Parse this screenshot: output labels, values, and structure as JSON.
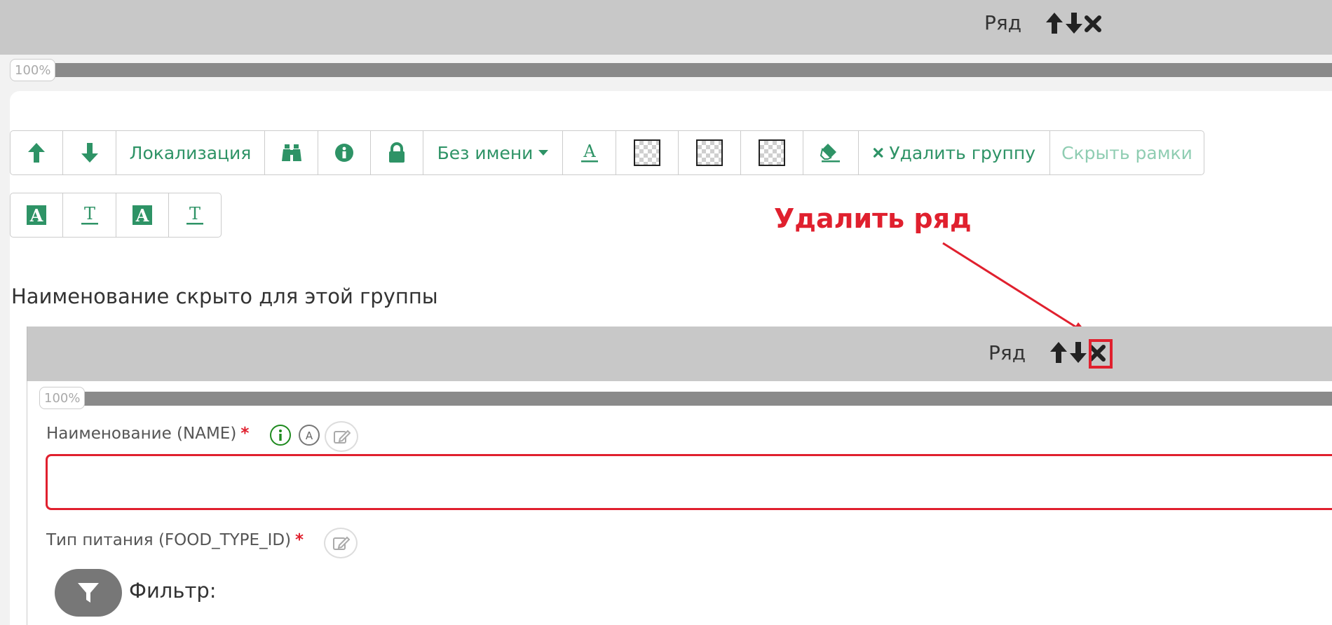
{
  "top_row": {
    "label": "Ряд"
  },
  "top_progress": {
    "badge": "100%"
  },
  "toolbar": {
    "localization_label": "Локализация",
    "no_name_label": "Без имени",
    "delete_group_label": "Удалить группу",
    "hide_frames_label": "Скрыть рамки"
  },
  "annotation": {
    "text": "Удалить ряд"
  },
  "group_note": "Наименование скрыто для этой группы",
  "inner_row": {
    "label": "Ряд"
  },
  "inner_progress": {
    "badge": "100%"
  },
  "fields": {
    "name": {
      "label": "Наименование (NAME)",
      "required_mark": "*",
      "value": ""
    },
    "food_type": {
      "label": "Тип питания (FOOD_TYPE_ID)",
      "required_mark": "*"
    }
  },
  "filter": {
    "label": "Фильтр:"
  },
  "colors": {
    "accent_green": "#2e9366",
    "annotation_red": "#e0202e",
    "bar_gray": "#c8c8c8"
  },
  "icons": [
    "arrow-up-icon",
    "arrow-down-icon",
    "close-icon",
    "binoculars-icon",
    "info-icon",
    "lock-icon",
    "text-color-icon",
    "eraser-icon",
    "filter-icon",
    "edit-icon"
  ]
}
